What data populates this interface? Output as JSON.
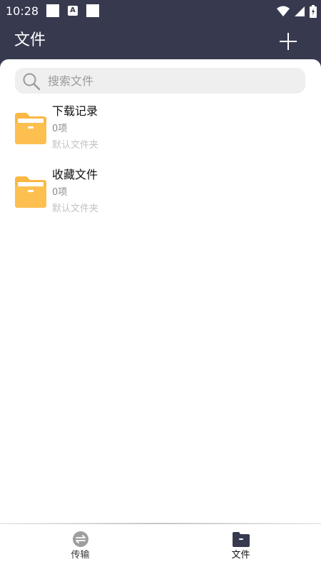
{
  "status_bar": {
    "time": "10:28"
  },
  "header": {
    "title": "文件"
  },
  "search": {
    "placeholder": "搜索文件"
  },
  "folders": [
    {
      "name": "下载记录",
      "count": "0项",
      "type": "默认文件夹"
    },
    {
      "name": "收藏文件",
      "count": "0项",
      "type": "默认文件夹"
    }
  ],
  "bottom_nav": {
    "items": [
      {
        "label": "传输",
        "icon": "transfer-icon",
        "active": false
      },
      {
        "label": "文件",
        "icon": "folder-icon",
        "active": true
      }
    ]
  },
  "colors": {
    "header_bg": "#373a4f",
    "folder_icon": "#fbb744",
    "nav_inactive": "#9e9e9e",
    "nav_active": "#373a4f"
  }
}
